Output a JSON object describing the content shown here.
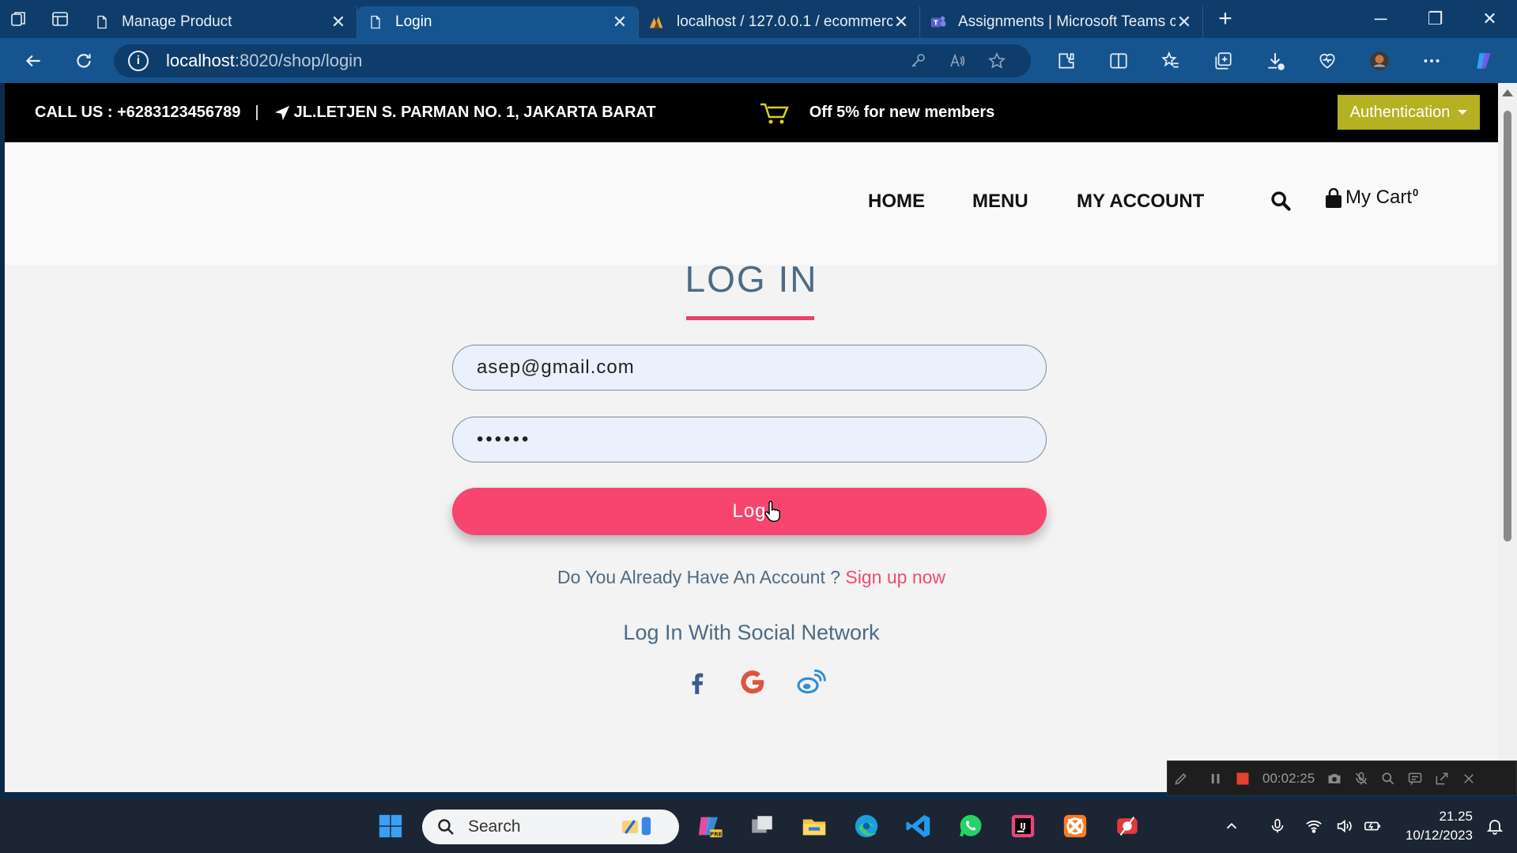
{
  "browser": {
    "tabs": [
      {
        "title": "Manage Product",
        "active": false
      },
      {
        "title": "Login",
        "active": true
      },
      {
        "title": "localhost / 127.0.0.1 / ecommerc",
        "active": false
      },
      {
        "title": "Assignments | Microsoft Teams c",
        "active": false
      }
    ],
    "url_host": "localhost",
    "url_rest": ":8020/shop/login"
  },
  "topbar": {
    "phone": "CALL US : +6283123456789",
    "address": "JL.LETJEN S. PARMAN NO. 1, JAKARTA BARAT",
    "promo": "Off 5% for new members",
    "auth_label": "Authentication"
  },
  "nav": {
    "home": "HOME",
    "menu": "MENU",
    "account": "MY ACCOUNT",
    "cart_label": "My Cart",
    "cart_count": "0"
  },
  "login": {
    "title": "LOG IN",
    "email_value": "asep@gmail.com",
    "password_mask": "••••••",
    "button_label": "Log",
    "signup_prompt": "Do You Already Have An Account ?",
    "signup_link": "Sign up now",
    "social_title": "Log In With Social Network"
  },
  "recorder": {
    "time": "00:02:25"
  },
  "taskbar": {
    "search_placeholder": "Search",
    "time": "21.25",
    "date": "10/12/2023"
  },
  "colors": {
    "accent_pink": "#f6466f",
    "auth_olive": "#b5b122",
    "heading_slate": "#4e6b83",
    "browser_blue": "#165490"
  }
}
